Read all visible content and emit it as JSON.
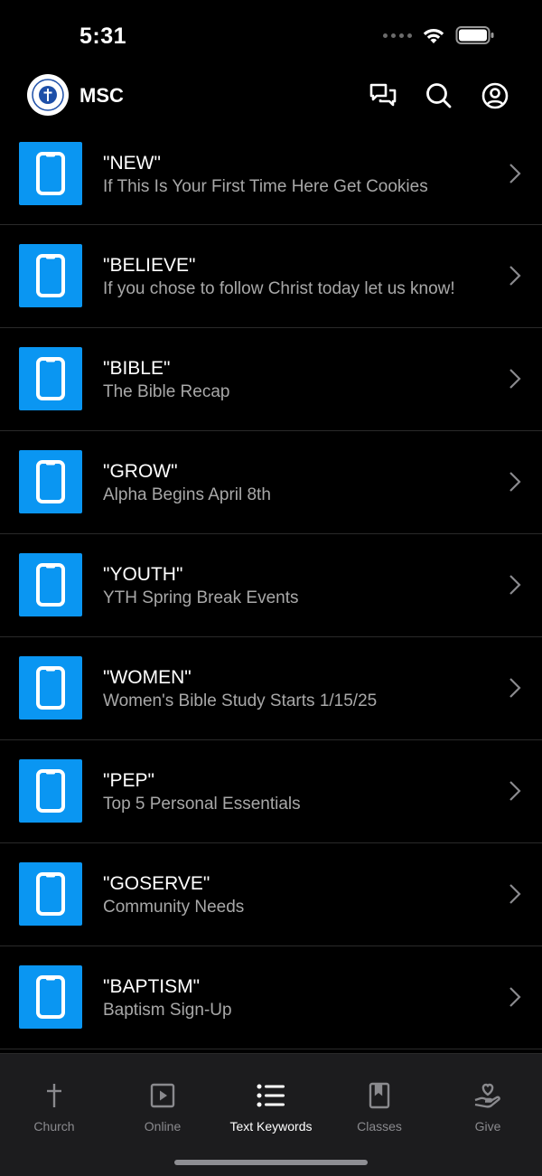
{
  "status_bar": {
    "time": "5:31"
  },
  "header": {
    "app_name": "MSC",
    "icons": [
      "chat-bubbles-icon",
      "search-icon",
      "profile-icon"
    ]
  },
  "colors": {
    "accent": "#0a96f2",
    "background": "#000000",
    "tab_bar": "#1c1c1e",
    "subtitle": "#a8a8a8"
  },
  "keywords": [
    {
      "title": "\"NEW\"",
      "subtitle": "If This Is Your First Time Here Get Cookies"
    },
    {
      "title": "\"BELIEVE\"",
      "subtitle": "If you chose to follow Christ today let us know!"
    },
    {
      "title": "\"BIBLE\"",
      "subtitle": "The Bible Recap"
    },
    {
      "title": "\"GROW\"",
      "subtitle": "Alpha Begins April 8th"
    },
    {
      "title": "\"YOUTH\"",
      "subtitle": "YTH Spring Break Events"
    },
    {
      "title": "\"WOMEN\"",
      "subtitle": "Women's Bible Study Starts 1/15/25"
    },
    {
      "title": "\"PEP\"",
      "subtitle": "Top 5 Personal Essentials"
    },
    {
      "title": "\"GOSERVE\"",
      "subtitle": "Community Needs"
    },
    {
      "title": "\"BAPTISM\"",
      "subtitle": "Baptism Sign-Up"
    }
  ],
  "tabs": [
    {
      "label": "Church",
      "icon": "cross-icon",
      "active": false
    },
    {
      "label": "Online",
      "icon": "play-icon",
      "active": false
    },
    {
      "label": "Text Keywords",
      "icon": "list-icon",
      "active": true
    },
    {
      "label": "Classes",
      "icon": "book-icon",
      "active": false
    },
    {
      "label": "Give",
      "icon": "heart-hand-icon",
      "active": false
    }
  ]
}
